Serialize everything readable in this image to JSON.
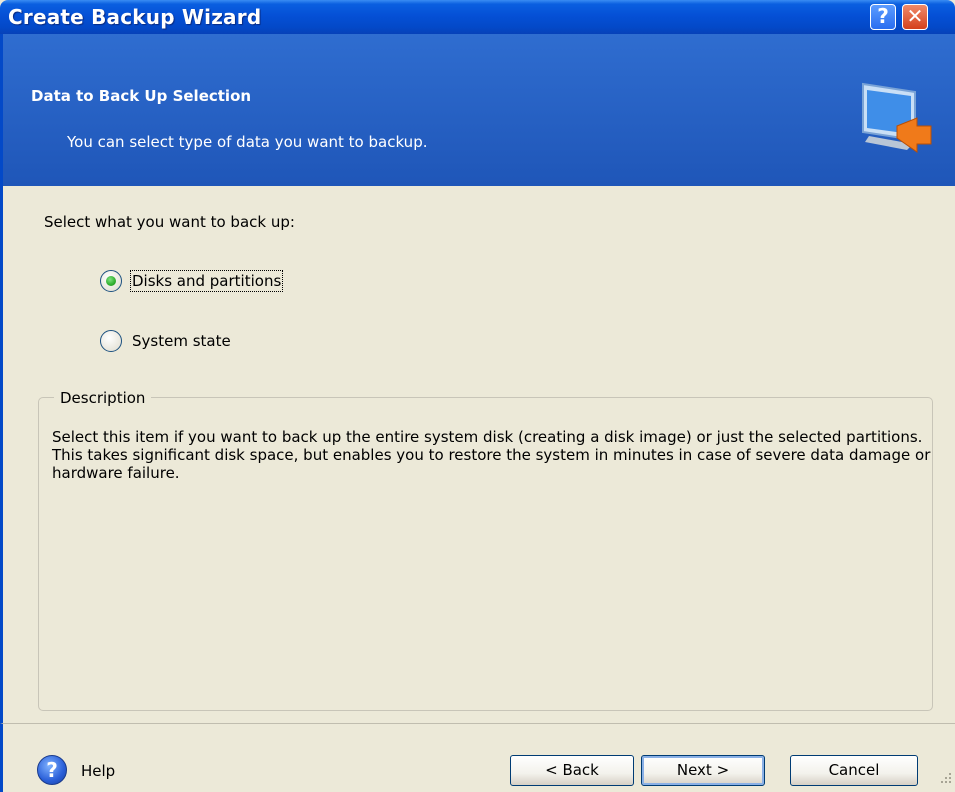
{
  "window": {
    "title": "Create Backup Wizard",
    "help_glyph": "?",
    "close_glyph": "✕"
  },
  "header": {
    "title": "Data to Back Up Selection",
    "subtitle": "You can select type of data you want to backup.",
    "icon": "monitor-arrow-icon"
  },
  "content": {
    "prompt": "Select what you want to back up:",
    "options": [
      {
        "label": "Disks and partitions",
        "checked": true
      },
      {
        "label": "System state",
        "checked": false
      }
    ],
    "description": {
      "legend": "Description",
      "text": "Select this item if you want to back up the entire system disk (creating a disk image) or just the selected partitions. This takes significant disk space, but enables you to restore the system in minutes in case of severe data damage or hardware failure."
    }
  },
  "footer": {
    "help_icon_glyph": "?",
    "help_label": "Help",
    "back_label": "< Back",
    "next_label": "Next >",
    "cancel_label": "Cancel"
  },
  "colors": {
    "titlebar": "#0550d6",
    "header": "#2f6dd0",
    "face": "#ece9d8",
    "radio_check": "#2fae2f"
  }
}
